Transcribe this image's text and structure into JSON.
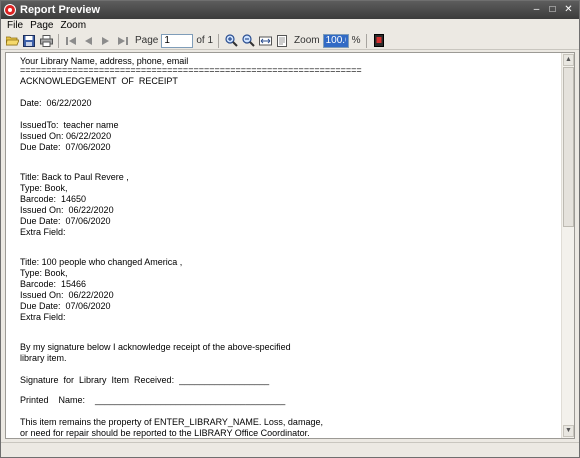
{
  "window": {
    "title": "Report Preview"
  },
  "menu": [
    "File",
    "Page",
    "Zoom"
  ],
  "toolbar": {
    "page_label": "Page",
    "page_value": "1",
    "of_label": "of 1",
    "zoom_label": "Zoom",
    "zoom_value": "100.0",
    "zoom_unit": "%"
  },
  "document": {
    "lines": [
      "Your Library Name, address, phone, email",
      "=================================================================",
      "ACKNOWLEDGEMENT  OF  RECEIPT",
      "Date:  06/22/2020",
      "IssuedTo:  teacher name",
      "Issued On: 06/22/2020",
      "Due Date:  07/06/2020",
      "Title: Back to Paul Revere ,",
      "Type: Book,",
      "Barcode:  14650",
      "Issued On:  06/22/2020",
      "Due Date:  07/06/2020",
      "Extra Field:",
      "Title: 100 people who changed America ,",
      "Type: Book,",
      "Barcode:  15466",
      "Issued On:  06/22/2020",
      "Due Date:  07/06/2020",
      "Extra Field:",
      "By my signature below I acknowledge receipt of the above-specified",
      "library item.",
      "Signature  for  Library  Item  Received:  __________________",
      "Printed    Name:    ______________________________________",
      "This item remains the property of ENTER_LIBRARY_NAME. Loss, damage,",
      "or need for repair should be reported to the LIBRARY Office Coordinator."
    ]
  }
}
